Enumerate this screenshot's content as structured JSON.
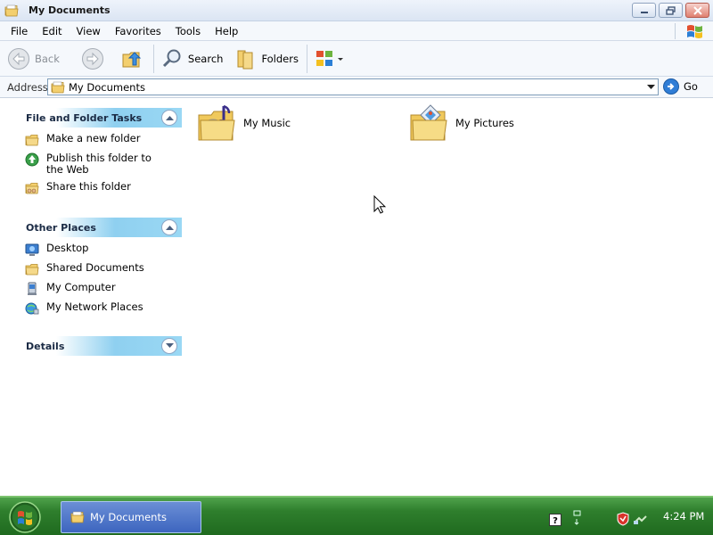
{
  "window": {
    "title": "My Documents",
    "icon": "folder-icon"
  },
  "menu": {
    "items": [
      "File",
      "Edit",
      "View",
      "Favorites",
      "Tools",
      "Help"
    ]
  },
  "toolbar": {
    "back_label": "Back",
    "search_label": "Search",
    "folders_label": "Folders"
  },
  "address": {
    "label": "Address",
    "value": "My Documents",
    "go_label": "Go"
  },
  "taskpane": {
    "file_tasks": {
      "title": "File and Folder Tasks",
      "items": [
        {
          "label": "Make a new folder",
          "icon": "new-folder-icon"
        },
        {
          "label": "Publish this folder to the Web",
          "icon": "publish-web-icon"
        },
        {
          "label": "Share this folder",
          "icon": "share-folder-icon"
        }
      ]
    },
    "other_places": {
      "title": "Other Places",
      "items": [
        {
          "label": "Desktop",
          "icon": "desktop-icon"
        },
        {
          "label": "Shared Documents",
          "icon": "shared-folder-icon"
        },
        {
          "label": "My Computer",
          "icon": "computer-icon"
        },
        {
          "label": "My Network Places",
          "icon": "network-icon"
        }
      ]
    },
    "details": {
      "title": "Details"
    }
  },
  "content": {
    "items": [
      {
        "label": "My Music",
        "icon": "music-folder-icon"
      },
      {
        "label": "My Pictures",
        "icon": "pictures-folder-icon"
      }
    ]
  },
  "taskbar": {
    "task_label": "My Documents",
    "clock": "4:24 PM"
  },
  "colors": {
    "taskbar_green": "#2f7f2d",
    "panel_header_blue": "#8fd0f0",
    "link_text": "#000000"
  }
}
